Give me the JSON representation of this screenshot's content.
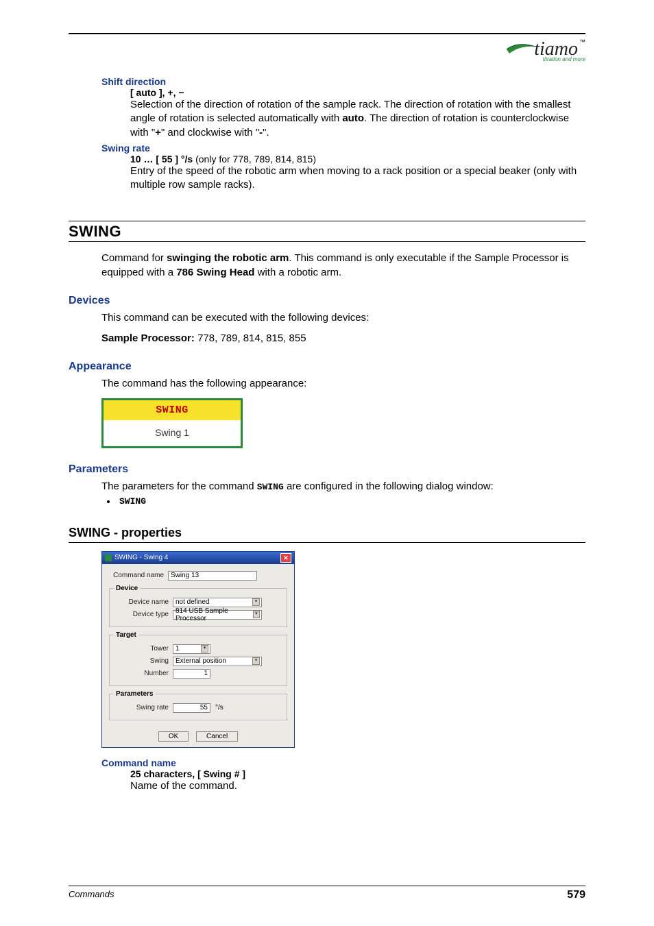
{
  "logo": {
    "text": "tiamo",
    "tm": "™",
    "sub": "titration and more"
  },
  "shift_direction": {
    "label": "Shift direction",
    "range": "[ auto ], +, −",
    "desc_pre": "Selection of the direction of rotation of the sample rack. The direction of rotation with the smallest angle of rotation is selected automatically with ",
    "auto": "auto",
    "desc_mid": ". The direction of rotation is counterclockwise with \"",
    "plus": "+",
    "desc_mid2": "\" and clockwise with \"",
    "minus": "-",
    "desc_end": "\"."
  },
  "swing_rate": {
    "label": "Swing rate",
    "range_bold": "10 … [ 55 ] °/s",
    "range_rest": " (only for 778, 789, 814, 815)",
    "desc": "Entry of the speed of the robotic arm when moving to a rack position or a special beaker (only with multiple row sample racks)."
  },
  "swing_section": {
    "title": "SWING",
    "intro_pre": "Command for ",
    "intro_bold": "swinging the robotic arm",
    "intro_mid": ". This command is only executable if the Sample Processor is equipped with a ",
    "intro_bold2": "786 Swing Head",
    "intro_end": " with a robotic arm."
  },
  "devices": {
    "title": "Devices",
    "line1": "This command can be executed with the following devices:",
    "label": "Sample Processor:",
    "list": " 778, 789, 814, 815, 855"
  },
  "appearance": {
    "title": "Appearance",
    "line": "The command has the following appearance:",
    "block_title": "SWING",
    "block_body": "Swing 1"
  },
  "parameters": {
    "title": "Parameters",
    "line_pre": "The parameters for the command ",
    "cmd": "SWING",
    "line_post": " are configured in the following dialog window:",
    "bullet": "SWING"
  },
  "properties": {
    "title": "SWING - properties",
    "dialog_title": "SWING - Swing 4",
    "fields": {
      "command_name_label": "Command name",
      "command_name_value": "Swing 13",
      "device_legend": "Device",
      "device_name_label": "Device name",
      "device_name_value": "not defined",
      "device_type_label": "Device type",
      "device_type_value": "814 USB Sample Processor",
      "target_legend": "Target",
      "tower_label": "Tower",
      "tower_value": "1",
      "swing_label": "Swing",
      "swing_value": "External position",
      "number_label": "Number",
      "number_value": "1",
      "params_legend": "Parameters",
      "swing_rate_label": "Swing rate",
      "swing_rate_value": "55",
      "swing_rate_unit": "°/s",
      "ok": "OK",
      "cancel": "Cancel"
    }
  },
  "command_name_block": {
    "label": "Command name",
    "range": "25 characters, [ Swing # ]",
    "desc": "Name of the command."
  },
  "footer": {
    "left": "Commands",
    "right": "579"
  }
}
